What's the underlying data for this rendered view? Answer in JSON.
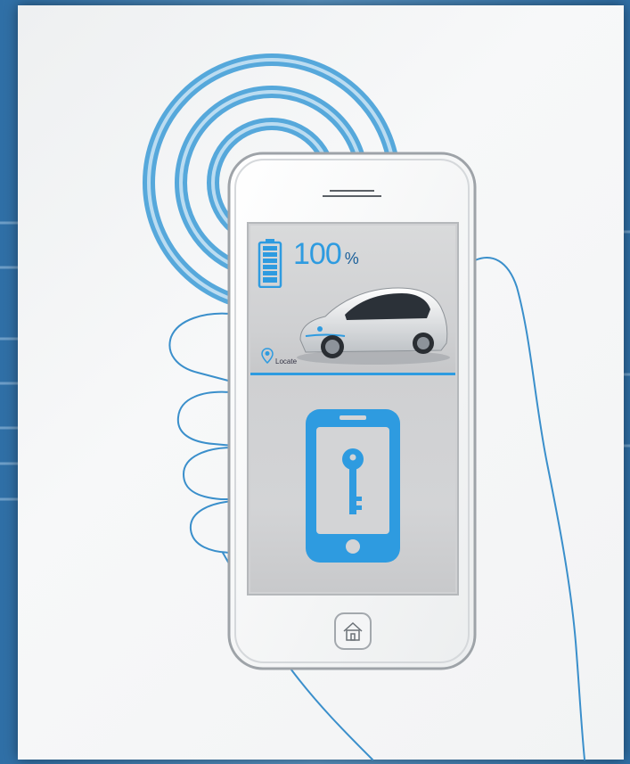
{
  "battery": {
    "value": "100",
    "unit": "%",
    "level": 1.0
  },
  "locate": {
    "label": "Locate"
  },
  "icons": {
    "battery": "battery-icon",
    "locate": "location-pin-icon",
    "car": "electric-car-image",
    "digital_key": "phone-key-icon",
    "home_button": "home-icon",
    "signal": "wireless-signal-icon"
  },
  "colors": {
    "accent": "#2e9be0",
    "background": "#3d7cb0",
    "outline": "#3a9ad6"
  }
}
